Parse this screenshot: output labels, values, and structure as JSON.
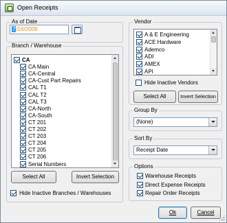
{
  "window": {
    "title": "Open Receipts"
  },
  "as_of_date": {
    "legend": "As of Date",
    "value_selected": "7",
    "value_rest": "/16/2009"
  },
  "branch": {
    "legend": "Branch / Warehouse",
    "items": [
      {
        "label": "CA",
        "checked": true,
        "bold": true,
        "level": 0
      },
      {
        "label": "CA Main",
        "checked": true,
        "level": 1
      },
      {
        "label": "CA-Central",
        "checked": true,
        "level": 1
      },
      {
        "label": "CA-Cust Part Repairs",
        "checked": true,
        "level": 1
      },
      {
        "label": "CAL T1",
        "checked": true,
        "level": 1
      },
      {
        "label": "CAL T2",
        "checked": true,
        "level": 1
      },
      {
        "label": "CAL T3",
        "checked": true,
        "level": 1
      },
      {
        "label": "CA-North",
        "checked": true,
        "level": 1
      },
      {
        "label": "CA-South",
        "checked": true,
        "level": 1
      },
      {
        "label": "CT 201",
        "checked": true,
        "level": 1
      },
      {
        "label": "CT 202",
        "checked": true,
        "level": 1
      },
      {
        "label": "CT 203",
        "checked": true,
        "level": 1
      },
      {
        "label": "CT 204",
        "checked": true,
        "level": 1
      },
      {
        "label": "CT 205",
        "checked": true,
        "level": 1
      },
      {
        "label": "CT 206",
        "checked": true,
        "level": 1
      },
      {
        "label": "Serial Numbers",
        "checked": true,
        "level": 1
      }
    ],
    "select_all": "Select All",
    "invert_selection": "Invert Selection",
    "hide_inactive": "Hide Inactive Branches / Warehouses",
    "hide_inactive_checked": true
  },
  "vendor": {
    "legend": "Vendor",
    "items": [
      {
        "label": "A & E Engineering",
        "checked": true
      },
      {
        "label": "ACE Hardware",
        "checked": true
      },
      {
        "label": "Ademco",
        "checked": true
      },
      {
        "label": "ADI",
        "checked": true
      },
      {
        "label": "AMEX",
        "checked": true
      },
      {
        "label": "API",
        "checked": true
      }
    ],
    "hide_inactive": "Hide Inactive Vendors",
    "hide_inactive_checked": false,
    "select_all": "Select All",
    "invert_selection": "Invert Selection"
  },
  "group_by": {
    "legend": "Group By",
    "value": "(None)"
  },
  "sort_by": {
    "legend": "Sort By",
    "value": "Receipt Date"
  },
  "options": {
    "legend": "Options",
    "items": [
      {
        "label": "Warehouse Receipts",
        "checked": true
      },
      {
        "label": "Direct Expense Receipts",
        "checked": true
      },
      {
        "label": "Repair Order Receipts",
        "checked": true
      }
    ]
  },
  "buttons": {
    "ok": "Ok",
    "cancel": "Cancel"
  },
  "colors": {
    "date_text": "#e8891c",
    "selection": "#3399ff",
    "default_button_border": "#3c7fb1"
  }
}
